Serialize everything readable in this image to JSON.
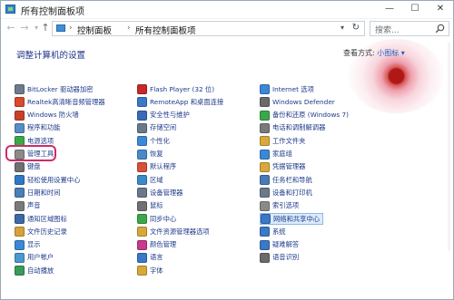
{
  "window": {
    "title": "所有控制面板项",
    "minimize": "—",
    "maximize": "☐",
    "close": "✕"
  },
  "address": {
    "root": "控制面板",
    "current": "所有控制面板项",
    "search_placeholder": "搜索..."
  },
  "content": {
    "heading": "调整计算机的设置",
    "view_by_label": "查看方式:",
    "view_by_value": "小图标 ▾"
  },
  "columns": [
    [
      {
        "label": "BitLocker 驱动器加密",
        "icon": "bitlocker-icon",
        "color": "#6f7b8a"
      },
      {
        "label": "Realtek高清晰音频管理器",
        "icon": "realtek-audio-icon",
        "color": "#d94a2a"
      },
      {
        "label": "Windows 防火墙",
        "icon": "firewall-icon",
        "color": "#c8402a"
      },
      {
        "label": "程序和功能",
        "icon": "programs-icon",
        "color": "#5a8cc8"
      },
      {
        "label": "电源选项",
        "icon": "power-icon",
        "color": "#3aa84a"
      },
      {
        "label": "管理工具",
        "icon": "admin-tools-icon",
        "color": "#8a8a8a"
      },
      {
        "label": "键盘",
        "icon": "keyboard-icon",
        "color": "#707070"
      },
      {
        "label": "轻松使用设置中心",
        "icon": "ease-of-access-icon",
        "color": "#2f78c8"
      },
      {
        "label": "日期和时间",
        "icon": "clock-icon",
        "color": "#4a7fb8"
      },
      {
        "label": "声音",
        "icon": "speaker-icon",
        "color": "#7a7a7a"
      },
      {
        "label": "通知区域图标",
        "icon": "notification-icon",
        "color": "#3a6aa8"
      },
      {
        "label": "文件历史记录",
        "icon": "file-history-icon",
        "color": "#d8a23a"
      },
      {
        "label": "显示",
        "icon": "display-icon",
        "color": "#3a88d8"
      },
      {
        "label": "用户帐户",
        "icon": "user-accounts-icon",
        "color": "#4a9ad0"
      },
      {
        "label": "自动播放",
        "icon": "autoplay-icon",
        "color": "#3a9a5a"
      }
    ],
    [
      {
        "label": "Flash Player (32 位)",
        "icon": "flash-icon",
        "color": "#c8282a"
      },
      {
        "label": "RemoteApp 和桌面连接",
        "icon": "remoteapp-icon",
        "color": "#3a78c8"
      },
      {
        "label": "安全性与维护",
        "icon": "flag-icon",
        "color": "#3a6ab8"
      },
      {
        "label": "存储空间",
        "icon": "storage-icon",
        "color": "#6a7a8a"
      },
      {
        "label": "个性化",
        "icon": "personalize-icon",
        "color": "#3a8ad8"
      },
      {
        "label": "恢复",
        "icon": "recovery-icon",
        "color": "#4a8ac8"
      },
      {
        "label": "默认程序",
        "icon": "default-programs-icon",
        "color": "#d8503a"
      },
      {
        "label": "区域",
        "icon": "region-icon",
        "color": "#3a8ac8"
      },
      {
        "label": "设备管理器",
        "icon": "device-manager-icon",
        "color": "#6a7a8a"
      },
      {
        "label": "鼠标",
        "icon": "mouse-icon",
        "color": "#707070"
      },
      {
        "label": "同步中心",
        "icon": "sync-icon",
        "color": "#3aa84a"
      },
      {
        "label": "文件资源管理器选项",
        "icon": "folder-options-icon",
        "color": "#d8a83a"
      },
      {
        "label": "颜色管理",
        "icon": "color-management-icon",
        "color": "#c83a8a"
      },
      {
        "label": "语言",
        "icon": "language-icon",
        "color": "#3a78c8"
      },
      {
        "label": "字体",
        "icon": "fonts-icon",
        "color": "#d8a83a"
      }
    ],
    [
      {
        "label": "Internet 选项",
        "icon": "internet-options-icon",
        "color": "#3a88d8"
      },
      {
        "label": "Windows Defender",
        "icon": "defender-icon",
        "color": "#6a6a6a"
      },
      {
        "label": "备份和还原 (Windows 7)",
        "icon": "backup-icon",
        "color": "#3aa84a"
      },
      {
        "label": "电话和调制解调器",
        "icon": "phone-modem-icon",
        "color": "#7a7a7a"
      },
      {
        "label": "工作文件夹",
        "icon": "work-folders-icon",
        "color": "#d8a83a"
      },
      {
        "label": "家庭组",
        "icon": "homegroup-icon",
        "color": "#3a88d8"
      },
      {
        "label": "凭据管理器",
        "icon": "credential-icon",
        "color": "#d8a83a"
      },
      {
        "label": "任务栏和导航",
        "icon": "taskbar-icon",
        "color": "#4a7ab8"
      },
      {
        "label": "设备和打印机",
        "icon": "printer-icon",
        "color": "#6a7a8a"
      },
      {
        "label": "索引选项",
        "icon": "indexing-icon",
        "color": "#8a8a8a"
      },
      {
        "label": "网络和共享中心",
        "icon": "network-icon",
        "color": "#3a78c8",
        "hover": true
      },
      {
        "label": "系统",
        "icon": "system-icon",
        "color": "#3a78c8"
      },
      {
        "label": "疑难解答",
        "icon": "troubleshoot-icon",
        "color": "#3a78c8"
      },
      {
        "label": "语音识别",
        "icon": "microphone-icon",
        "color": "#6a6a6a"
      }
    ]
  ],
  "colors": {
    "link": "#1d3a8a",
    "heading": "#1e3287",
    "highlight_ring": "#cc2c6a",
    "hover_background": "#dcebfb"
  }
}
